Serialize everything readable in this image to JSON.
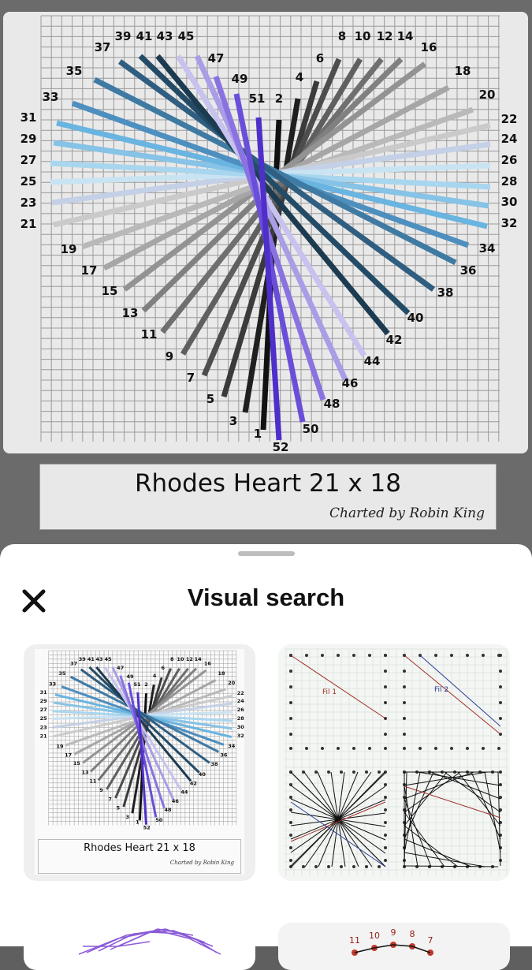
{
  "chart": {
    "title": "Rhodes Heart 21 x 18",
    "credit": "Charted by Robin King",
    "lines": [
      {
        "a": 1,
        "b": 2,
        "color": "#111111"
      },
      {
        "a": 3,
        "b": 4,
        "color": "#1f1f1f"
      },
      {
        "a": 5,
        "b": 6,
        "color": "#3a3a3a"
      },
      {
        "a": 7,
        "b": 8,
        "color": "#4d4d4d"
      },
      {
        "a": 9,
        "b": 10,
        "color": "#5f5f5f"
      },
      {
        "a": 11,
        "b": 12,
        "color": "#6f6f6f"
      },
      {
        "a": 13,
        "b": 14,
        "color": "#808080"
      },
      {
        "a": 15,
        "b": 16,
        "color": "#939393"
      },
      {
        "a": 17,
        "b": 18,
        "color": "#a6a6a6"
      },
      {
        "a": 19,
        "b": 20,
        "color": "#b9b9b9"
      },
      {
        "a": 21,
        "b": 22,
        "color": "#cacaca"
      },
      {
        "a": 23,
        "b": 24,
        "color": "#c4d0e6"
      },
      {
        "a": 25,
        "b": 26,
        "color": "#c8e3f2"
      },
      {
        "a": 27,
        "b": 28,
        "color": "#a8d6ee"
      },
      {
        "a": 29,
        "b": 30,
        "color": "#86c3e6"
      },
      {
        "a": 31,
        "b": 32,
        "color": "#69b4e0"
      },
      {
        "a": 33,
        "b": 34,
        "color": "#4d8fbf"
      },
      {
        "a": 35,
        "b": 36,
        "color": "#3f7aa3"
      },
      {
        "a": 37,
        "b": 38,
        "color": "#2f5e80"
      },
      {
        "a": 39,
        "b": 40,
        "color": "#244b66"
      },
      {
        "a": 41,
        "b": 42,
        "color": "#1d3b50"
      },
      {
        "a": 43,
        "b": 44,
        "color": "#c7c2ee"
      },
      {
        "a": 45,
        "b": 46,
        "color": "#a99de6"
      },
      {
        "a": 47,
        "b": 48,
        "color": "#8a73e0"
      },
      {
        "a": 49,
        "b": 50,
        "color": "#6a4ed9"
      },
      {
        "a": 51,
        "b": 52,
        "color": "#4f2fc9"
      }
    ]
  },
  "sheet": {
    "title": "Visual search",
    "close_icon": "close-icon",
    "results": [
      {
        "title": "Rhodes Heart 21 x 18",
        "credit": "Charted by Robin King"
      },
      {
        "labels": [
          "Fil 1",
          "Fil 2"
        ]
      }
    ],
    "partial": {
      "numbers": [
        "11",
        "10",
        "9",
        "8",
        "7"
      ]
    }
  }
}
